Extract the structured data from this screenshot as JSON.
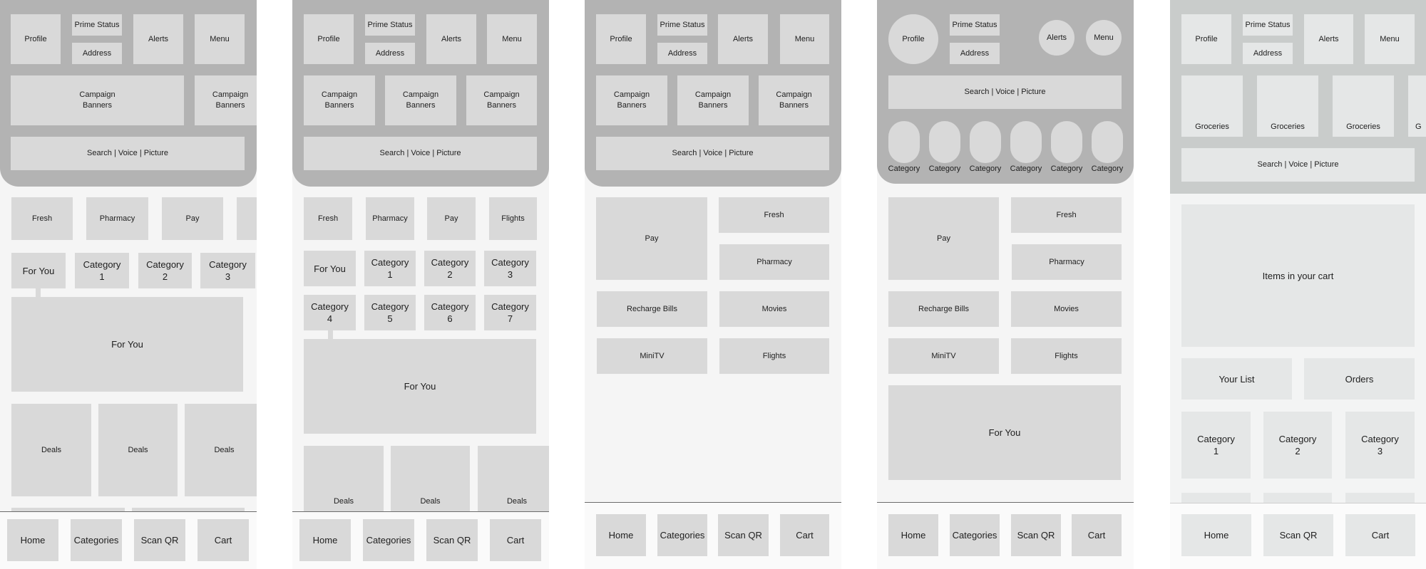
{
  "screens": [
    {
      "name": "home-variant-1",
      "header": {
        "profile": "Profile",
        "prime_status": "Prime Status",
        "address": "Address",
        "alerts": "Alerts",
        "menu": "Menu",
        "banners": [
          "Campaign\nBanners",
          "Campaign\nBanners"
        ],
        "search": "Search | Voice | Picture"
      },
      "quick_links": [
        "Fresh",
        "Pharmacy",
        "Pay",
        ""
      ],
      "category_tabs": [
        "For You",
        "Category\n1",
        "Category\n2",
        "Category\n3"
      ],
      "feature_panel": "For You",
      "deals": [
        "Deals",
        "Deals",
        "Deals"
      ],
      "nav": [
        "Home",
        "Categories",
        "Scan QR",
        "Cart"
      ]
    },
    {
      "name": "home-variant-2",
      "header": {
        "profile": "Profile",
        "prime_status": "Prime Status",
        "address": "Address",
        "alerts": "Alerts",
        "menu": "Menu",
        "banners": [
          "Campaign\nBanners",
          "Campaign\nBanners",
          "Campaign\nBanners"
        ],
        "search": "Search | Voice | Picture"
      },
      "quick_links": [
        "Fresh",
        "Pharmacy",
        "Pay",
        "Flights"
      ],
      "category_tabs": [
        "For You",
        "Category\n1",
        "Category\n2",
        "Category\n3",
        "Category\n4",
        "Category\n5",
        "Category\n6",
        "Category\n7"
      ],
      "feature_panel": "For You",
      "deals": [
        "Deals",
        "Deals",
        "Deals"
      ],
      "nav": [
        "Home",
        "Categories",
        "Scan QR",
        "Cart"
      ]
    },
    {
      "name": "home-variant-3",
      "header": {
        "profile": "Profile",
        "prime_status": "Prime Status",
        "address": "Address",
        "alerts": "Alerts",
        "menu": "Menu",
        "banners": [
          "Campaign\nBanners",
          "Campaign\nBanners",
          "Campaign\nBanners"
        ],
        "search": "Search | Voice | Picture"
      },
      "services": {
        "pay": "Pay",
        "fresh": "Fresh",
        "pharmacy": "Pharmacy",
        "recharge": "Recharge Bills",
        "movies": "Movies",
        "minitv": "MiniTV",
        "flights": "Flights"
      },
      "nav": [
        "Home",
        "Categories",
        "Scan QR",
        "Cart"
      ]
    },
    {
      "name": "home-variant-4",
      "header": {
        "profile": "Profile",
        "prime_status": "Prime Status",
        "address": "Address",
        "alerts": "Alerts",
        "menu": "Menu",
        "search": "Search | Voice | Picture",
        "categories": [
          "Category",
          "Category",
          "Category",
          "Category",
          "Category",
          "Category"
        ]
      },
      "services": {
        "pay": "Pay",
        "fresh": "Fresh",
        "pharmacy": "Pharmacy",
        "recharge": "Recharge Bills",
        "movies": "Movies",
        "minitv": "MiniTV",
        "flights": "Flights"
      },
      "feature_panel": "For You",
      "nav": [
        "Home",
        "Categories",
        "Scan QR",
        "Cart"
      ]
    },
    {
      "name": "home-variant-5",
      "header": {
        "profile": "Profile",
        "prime_status": "Prime Status",
        "address": "Address",
        "alerts": "Alerts",
        "menu": "Menu",
        "groceries": [
          "Groceries",
          "Groceries",
          "Groceries",
          "G"
        ],
        "search": "Search | Voice | Picture"
      },
      "cart_panel": "Items in your cart",
      "your_list": "Your List",
      "orders": "Orders",
      "categories": [
        "Category\n1",
        "Category\n2",
        "Category\n3"
      ],
      "nav": [
        "Home",
        "Scan QR",
        "Cart"
      ]
    }
  ],
  "colors": {
    "header_gray": "#b3b3b3",
    "box_gray": "#d9d9d9",
    "page_bg": "#f5f5f5",
    "header_variant5": "#c9cccb",
    "box_variant5": "#e5e7e7"
  }
}
